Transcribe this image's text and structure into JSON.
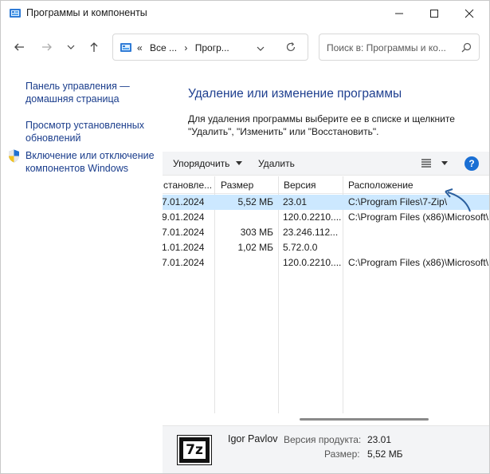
{
  "window": {
    "title": "Программы и компоненты",
    "minimize_icon": "minimize-icon",
    "maximize_icon": "maximize-icon",
    "close_icon": "close-icon"
  },
  "navigation": {
    "back_icon": "back-arrow-icon",
    "forward_icon": "forward-arrow-icon",
    "recent_icon": "chevron-down-icon",
    "up_icon": "up-arrow-icon",
    "address": {
      "prefix": "«",
      "crumb1": "Все ...",
      "sep": "›",
      "crumb2": "Прогр..."
    },
    "search_placeholder": "Поиск в: Программы и ко..."
  },
  "left_pane": {
    "home_link_line1": "Панель управления —",
    "home_link_line2": "домашняя страница",
    "updates_link_line1": "Просмотр установленных",
    "updates_link_line2": "обновлений",
    "features_link_line1": "Включение или отключение",
    "features_link_line2": "компонентов Windows"
  },
  "main": {
    "heading": "Удаление или изменение программы",
    "description_line1": "Для удаления программы выберите ее в списке и щелкните",
    "description_line2": "\"Удалить\", \"Изменить\" или \"Восстановить\"."
  },
  "toolbar": {
    "organize_label": "Упорядочить",
    "uninstall_label": "Удалить",
    "help_label": "?"
  },
  "table": {
    "columns": [
      "становле...",
      "Размер",
      "Версия",
      "Расположение"
    ],
    "rows": [
      {
        "installed": "7.01.2024",
        "size": "5,52 МБ",
        "version": "23.01",
        "location": "C:\\Program Files\\7-Zip\\"
      },
      {
        "installed": "9.01.2024",
        "size": "",
        "version": "120.0.2210....",
        "location": "C:\\Program Files (x86)\\Microsoft\\"
      },
      {
        "installed": "7.01.2024",
        "size": "303 МБ",
        "version": "23.246.112...",
        "location": ""
      },
      {
        "installed": "1.01.2024",
        "size": "1,02 МБ",
        "version": "5.72.0.0",
        "location": ""
      },
      {
        "installed": "7.01.2024",
        "size": "",
        "version": "120.0.2210....",
        "location": "C:\\Program Files (x86)\\Microsoft\\"
      }
    ]
  },
  "details": {
    "icon_text": "7z",
    "publisher": "Igor Pavlov",
    "version_label": "Версия продукта:",
    "version_value": "23.01",
    "size_label": "Размер:",
    "size_value": "5,52 МБ"
  },
  "colors": {
    "link": "#1a3d8c",
    "heading": "#1e3f8f",
    "selection": "#cce8ff",
    "arrow_annotation": "#2b5f9e"
  }
}
